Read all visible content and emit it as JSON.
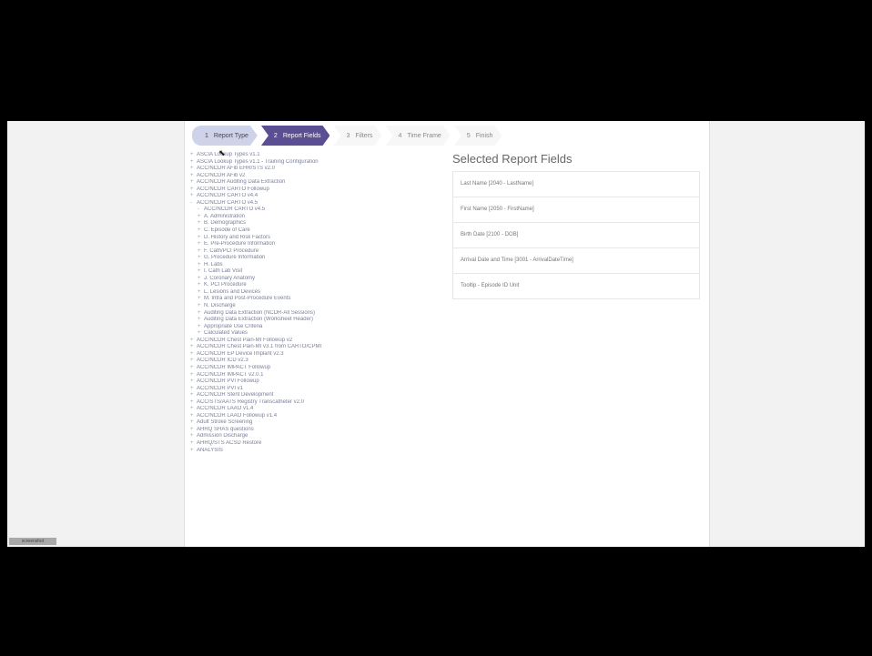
{
  "wizard": {
    "steps": [
      {
        "num": "1",
        "label": "Report Type"
      },
      {
        "num": "2",
        "label": "Report Fields"
      },
      {
        "num": "3",
        "label": "Filters"
      },
      {
        "num": "4",
        "label": "Time Frame"
      },
      {
        "num": "5",
        "label": "Finish"
      }
    ],
    "active_index": 1
  },
  "tree": {
    "items": [
      {
        "label": "ASCIA Lookup Types v1.1",
        "level": 0,
        "toggle": "+"
      },
      {
        "label": "ASCIA Lookup Types v1.1 - Training Configuration",
        "level": 0,
        "toggle": "+"
      },
      {
        "label": "ACC/NCDR AFib EHR/STS v2.0",
        "level": 0,
        "toggle": "+"
      },
      {
        "label": "ACC/NCDR AFib v2",
        "level": 0,
        "toggle": "+"
      },
      {
        "label": "ACC/NCDR Auditing Data Extraction",
        "level": 0,
        "toggle": "+"
      },
      {
        "label": "ACC/NCDR CARTO Followup",
        "level": 0,
        "toggle": "+"
      },
      {
        "label": "ACC/NCDR CARTO v4.4",
        "level": 0,
        "toggle": "+"
      },
      {
        "label": "ACC/NCDR CARTO v4.5",
        "level": 0,
        "toggle": "-"
      },
      {
        "label": "ACC/NCDR CARTO v4.5",
        "level": 1,
        "toggle": "-"
      },
      {
        "label": "A. Administration",
        "level": 1,
        "toggle": "+"
      },
      {
        "label": "B. Demographics",
        "level": 1,
        "toggle": "+"
      },
      {
        "label": "C. Episode of Care",
        "level": 1,
        "toggle": "+"
      },
      {
        "label": "D. History and Risk Factors",
        "level": 1,
        "toggle": "+"
      },
      {
        "label": "E. Pre-Procedure Information",
        "level": 1,
        "toggle": "+"
      },
      {
        "label": "F. Cath/PCI Procedure",
        "level": 1,
        "toggle": "+"
      },
      {
        "label": "G. Procedure Information",
        "level": 1,
        "toggle": "+"
      },
      {
        "label": "H. Labs",
        "level": 1,
        "toggle": "+"
      },
      {
        "label": "I. Cath Lab Visit",
        "level": 1,
        "toggle": "+"
      },
      {
        "label": "J. Coronary Anatomy",
        "level": 1,
        "toggle": "+"
      },
      {
        "label": "K. PCI Procedure",
        "level": 1,
        "toggle": "+"
      },
      {
        "label": "L. Lesions and Devices",
        "level": 1,
        "toggle": "+"
      },
      {
        "label": "M. Intra and Post-Procedure Events",
        "level": 1,
        "toggle": "+"
      },
      {
        "label": "N. Discharge",
        "level": 1,
        "toggle": "+"
      },
      {
        "label": "Auditing Data Extraction (NCDR-All Sessions)",
        "level": 1,
        "toggle": "+"
      },
      {
        "label": "Auditing Data Extraction (Worksheet Header)",
        "level": 1,
        "toggle": "+"
      },
      {
        "label": "Appropriate Use Criteria",
        "level": 1,
        "toggle": "+"
      },
      {
        "label": "Calculated Values",
        "level": 1,
        "toggle": "+"
      },
      {
        "label": "ACC/NCDR Chest Pain-MI Followup v2",
        "level": 0,
        "toggle": "+"
      },
      {
        "label": "ACC/NCDR Chest Pain-MI v3.1 from CARTO/CPMI",
        "level": 0,
        "toggle": "+"
      },
      {
        "label": "ACC/NCDR EP Device Implant v2.3",
        "level": 0,
        "toggle": "+"
      },
      {
        "label": "ACC/NCDR ICD v2.3",
        "level": 0,
        "toggle": "+"
      },
      {
        "label": "ACC/NCDR IMPACT Followup",
        "level": 0,
        "toggle": "+"
      },
      {
        "label": "ACC/NCDR IMPACT v2.0.1",
        "level": 0,
        "toggle": "+"
      },
      {
        "label": "ACC/NCDR PVI Followup",
        "level": 0,
        "toggle": "+"
      },
      {
        "label": "ACC/NCDR PVI v1",
        "level": 0,
        "toggle": "+"
      },
      {
        "label": "ACC/NCDR Stent Development",
        "level": 0,
        "toggle": "+"
      },
      {
        "label": "ACC/STS/AATS Registry Transcatheter v2.0",
        "level": 0,
        "toggle": "+"
      },
      {
        "label": "ACC/NCDR LAAO v1.4",
        "level": 0,
        "toggle": "+"
      },
      {
        "label": "ACC/NCDR LAAO Followup v1.4",
        "level": 0,
        "toggle": "+"
      },
      {
        "label": "Adult Stroke Screening",
        "level": 0,
        "toggle": "+"
      },
      {
        "label": "AHRQ SHAS questions",
        "level": 0,
        "toggle": "+"
      },
      {
        "label": "Admission Discharge",
        "level": 0,
        "toggle": "+"
      },
      {
        "label": "AHRQ/STS ACSD Restore",
        "level": 0,
        "toggle": "+"
      },
      {
        "label": "ANALYSIS",
        "level": 0,
        "toggle": "+"
      }
    ]
  },
  "selected": {
    "title": "Selected Report Fields",
    "fields": [
      "Last Name [2040 - LastName]",
      "First Name [2050 - FirstName]",
      "Birth Date [2100 - DOB]",
      "Arrival Date and Time [3001 - ArrivalDateTime]",
      "Tooltip - Episode ID Unit"
    ]
  },
  "status_chip": "screenshot"
}
